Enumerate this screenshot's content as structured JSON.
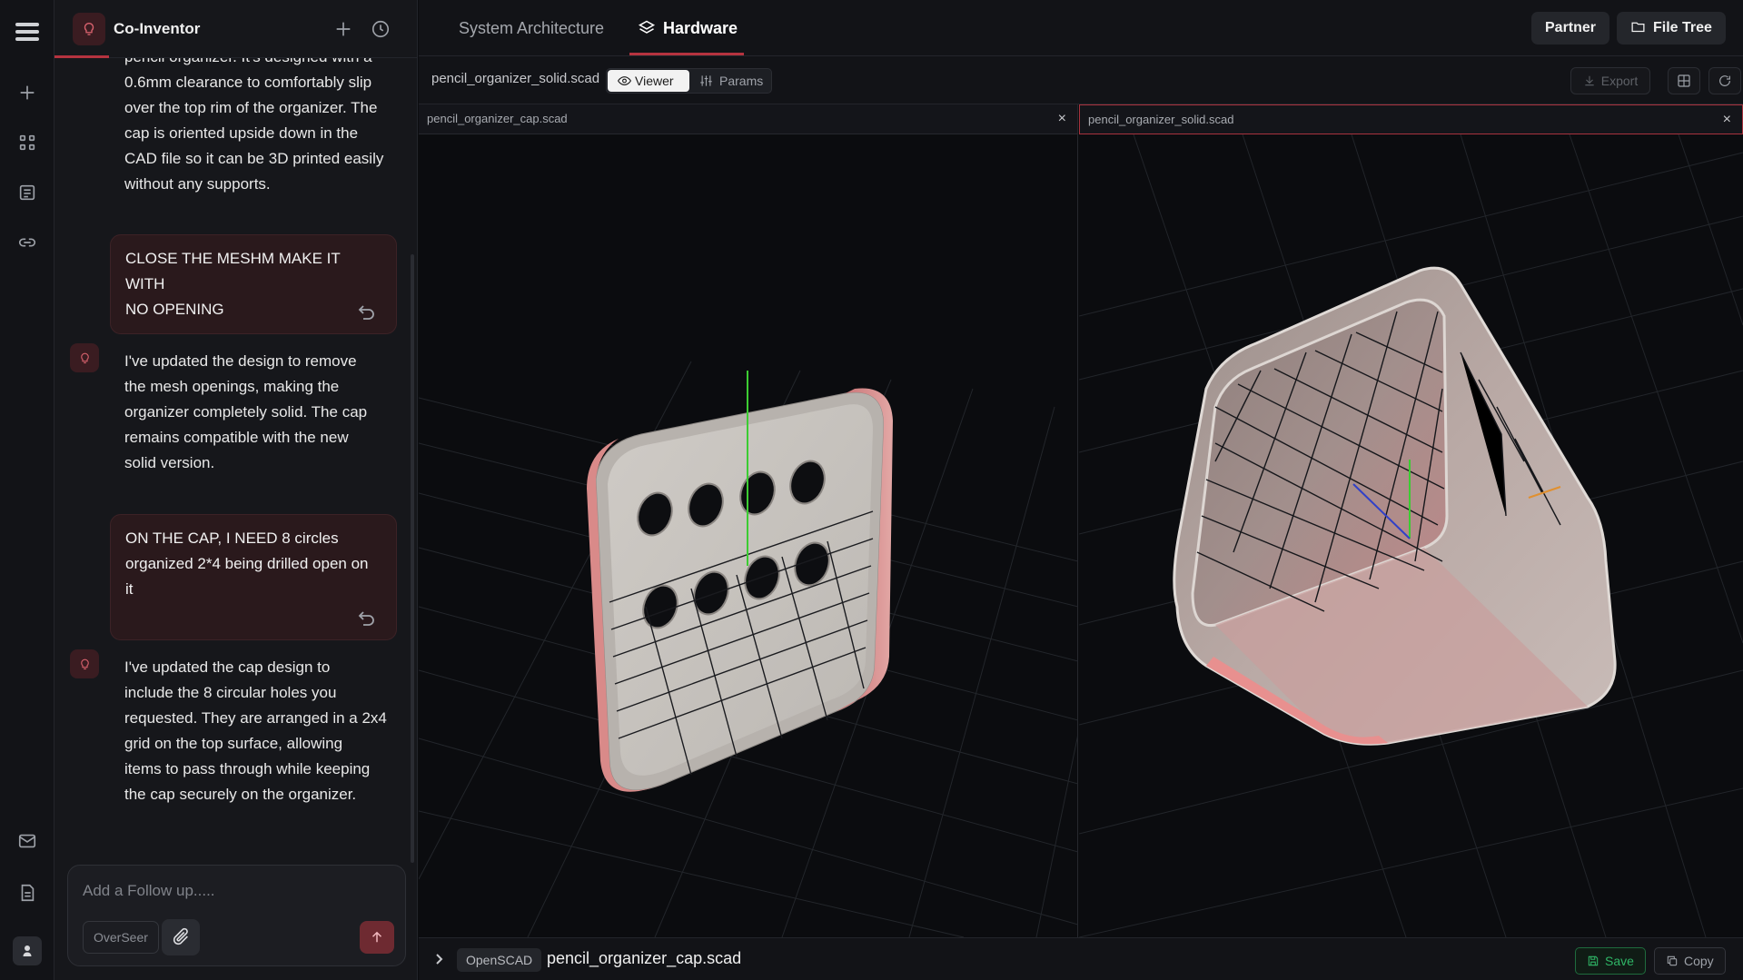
{
  "colors": {
    "accent": "#b5333f",
    "save_green": "#2fb566",
    "background": "#0b0c0f"
  },
  "rail": {
    "icons": [
      "logo-icon",
      "plus-icon",
      "apps-grid-icon",
      "document-icon",
      "link-icon",
      "mail-icon",
      "file-icon",
      "user-avatar"
    ]
  },
  "chat": {
    "title": "Co-Inventor",
    "messages": [
      {
        "role": "assistant",
        "lines": [
          "pencil organizer. It's designed with a",
          "0.6mm clearance to comfortably slip",
          "over the top rim of the organizer. The",
          "cap is oriented upside down in the",
          "CAD file so it can be 3D printed easily",
          "without any supports."
        ]
      },
      {
        "role": "user",
        "lines": [
          "CLOSE THE MESHM MAKE IT WITH",
          "NO OPENING"
        ]
      },
      {
        "role": "assistant",
        "lines": [
          "I've updated the design to remove",
          "the mesh openings, making the",
          "organizer completely solid. The cap",
          "remains compatible with the new",
          "solid version."
        ]
      },
      {
        "role": "user",
        "lines": [
          "ON THE CAP, I NEED 8 circles",
          "organized 2*4 being drilled open on",
          "it"
        ]
      },
      {
        "role": "assistant",
        "lines": [
          "I've updated the cap design to",
          "include the 8 circular holes you",
          "requested. They are arranged in a 2x4",
          "grid on the top surface, allowing",
          "items to pass through while keeping",
          "the cap securely on the organizer."
        ]
      }
    ],
    "composer": {
      "placeholder": "Add a Follow up.....",
      "mode": "OverSeer"
    }
  },
  "topbar": {
    "tabs": [
      {
        "label": "System Architecture",
        "active": false
      },
      {
        "label": "Hardware",
        "active": true
      }
    ],
    "partner": "Partner",
    "file_tree": "File Tree"
  },
  "toolbar": {
    "filename": "pencil_organizer_solid.scad",
    "viewer": "Viewer",
    "params": "Params",
    "export": "Export"
  },
  "panes": {
    "left": {
      "tab": "pencil_organizer_cap.scad",
      "close": "×"
    },
    "right": {
      "tab": "pencil_organizer_solid.scad",
      "close": "×"
    }
  },
  "bottombar": {
    "language": "OpenSCAD",
    "filename": "pencil_organizer_cap.scad",
    "save": "Save",
    "copy": "Copy"
  }
}
